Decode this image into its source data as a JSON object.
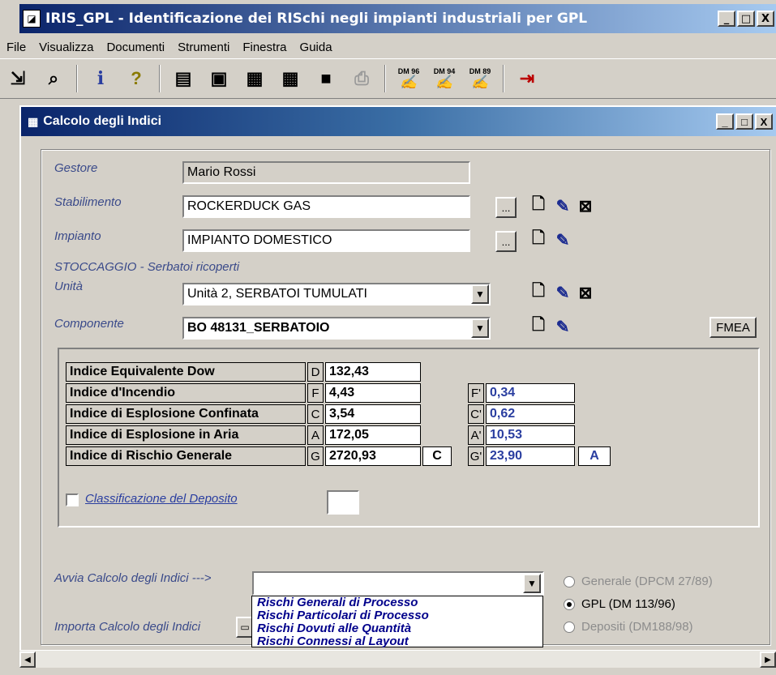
{
  "app": {
    "title": "IRIS_GPL - Identificazione dei RISchi negli impianti industriali  per GPL",
    "min": "_",
    "max": "□",
    "close": "X"
  },
  "menu": [
    "File",
    "Visualizza",
    "Documenti",
    "Strumenti",
    "Finestra",
    "Guida"
  ],
  "toolbar": {
    "dm96": "DM 96",
    "dm94": "DM 94",
    "dm89": "DM 89"
  },
  "child": {
    "title": "Calcolo degli Indici"
  },
  "form": {
    "gestore_label": "Gestore",
    "gestore_value": "Mario Rossi",
    "stabilimento_label": "Stabilimento",
    "stabilimento_value": "ROCKERDUCK GAS",
    "impianto_label": "Impianto",
    "impianto_value": "IMPIANTO DOMESTICO",
    "section_label": "STOCCAGGIO - Serbatoi ricoperti",
    "unita_label": "Unità",
    "unita_value": "Unità 2, SERBATOI TUMULATI",
    "componente_label": "Componente",
    "componente_value": "BO 48131_SERBATOIO",
    "fmea_label": "FMEA",
    "ellipsis": "..."
  },
  "indices": {
    "rows": [
      {
        "label": "Indice Equivalente Dow",
        "letter": "D",
        "value": "132,43"
      },
      {
        "label": "Indice d'Incendio",
        "letter": "F",
        "value": "4,43",
        "prime_letter": "F'",
        "prime_value": "0,34"
      },
      {
        "label": "Indice di Esplosione Confinata",
        "letter": "C",
        "value": "3,54",
        "prime_letter": "C'",
        "prime_value": "0,62"
      },
      {
        "label": "Indice di Esplosione in Aria",
        "letter": "A",
        "value": "172,05",
        "prime_letter": "A'",
        "prime_value": "10,53"
      },
      {
        "label": "Indice di Rischio Generale",
        "letter": "G",
        "value": "2720,93",
        "class": "C",
        "prime_letter": "G'",
        "prime_value": "23,90",
        "prime_class": "A"
      }
    ],
    "classificazione_label": "Classificazione del Deposito"
  },
  "avvia": {
    "label": "Avvia Calcolo degli Indici  --->",
    "importa_label": "Importa Calcolo degli Indici",
    "options": [
      "Rischi Generali di Processo",
      "Rischi Particolari di Processo",
      "Rischi Dovuti alle Quantità",
      "Rischi Connessi al Layout"
    ]
  },
  "radios": [
    {
      "label": "Generale (DPCM 27/89)",
      "checked": false,
      "disabled": true
    },
    {
      "label": "GPL (DM 113/96)",
      "checked": true,
      "disabled": false
    },
    {
      "label": "Depositi (DM188/98)",
      "checked": false,
      "disabled": true
    }
  ]
}
